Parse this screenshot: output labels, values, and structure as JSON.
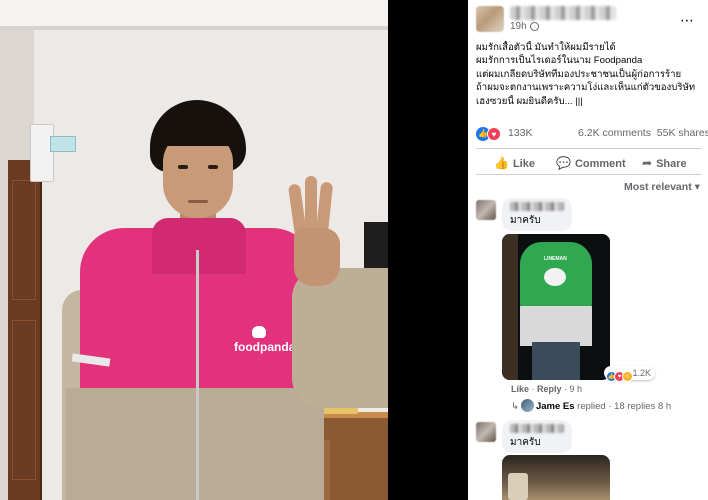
{
  "post": {
    "time": "19h",
    "text_lines": [
      "ผมรักเสื้อตัวนี้ มันทำให้ผมมีรายได้",
      "ผมรักการเป็นไรเดอร์ในนาม Foodpanda",
      "แต่ผมเกลียดบริษัทที่มองประชาชนเป็นผู้ก่อการร้าย",
      "ถ้าผมจะตกงานเพราะความโง่และเห็นแก่ตัวของบริษัท",
      "เฮงซวยนี้ ผมยินดีครับ... |||"
    ],
    "reaction_count": "133K",
    "comments": "6.2K comments",
    "shares": "55K shares"
  },
  "actions": {
    "like": "Like",
    "comment": "Comment",
    "share": "Share"
  },
  "sort_label": "Most relevant",
  "photo": {
    "brand": "foodpanda"
  },
  "comments": [
    {
      "text": "มาครับ",
      "image_text": "LINEMAN",
      "meta_like": "Like",
      "meta_reply": "Reply",
      "meta_time": "9 h",
      "reaction_count": "1.2K",
      "replies": {
        "author": "Jame Es",
        "text": "replied · 18 replies",
        "time": "8 h"
      }
    },
    {
      "text": "มาครับ"
    }
  ],
  "colors": {
    "brand_pink": "#e3327c",
    "facebook_blue": "#1877f2",
    "love_red": "#f33e58",
    "lineman_green": "#2fa84f"
  },
  "icons": {
    "more": "⋯",
    "like": "👍",
    "comment": "💬",
    "share": "➦",
    "sort": "▾",
    "reply": "↳"
  }
}
